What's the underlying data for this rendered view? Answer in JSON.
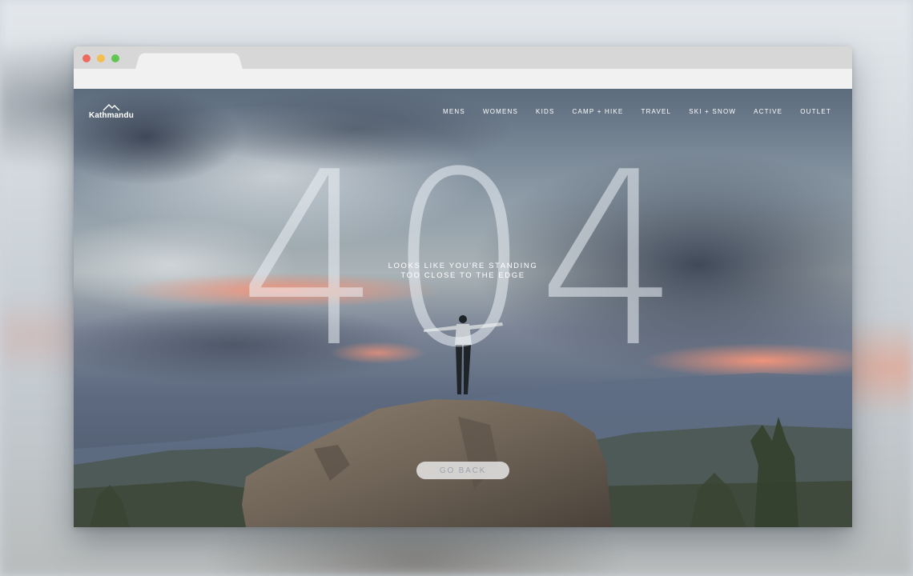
{
  "brand": {
    "name": "Kathmandu",
    "logo_icon": "mountain-peaks-icon"
  },
  "nav": {
    "items": [
      "MENS",
      "WOMENS",
      "KIDS",
      "CAMP + HIKE",
      "TRAVEL",
      "SKI + SNOW",
      "ACTIVE",
      "OUTLET"
    ]
  },
  "error": {
    "code": "404",
    "line1": "LOOKS LIKE YOU'RE STANDING",
    "line2": "TOO CLOSE TO THE EDGE"
  },
  "actions": {
    "go_back_label": "GO BACK"
  },
  "colors": {
    "sunset_glow": "#f08a6e",
    "storm_cloud": "#3e4756",
    "window_dots": [
      "#ec6a5e",
      "#f4bf4f",
      "#61c554"
    ]
  }
}
